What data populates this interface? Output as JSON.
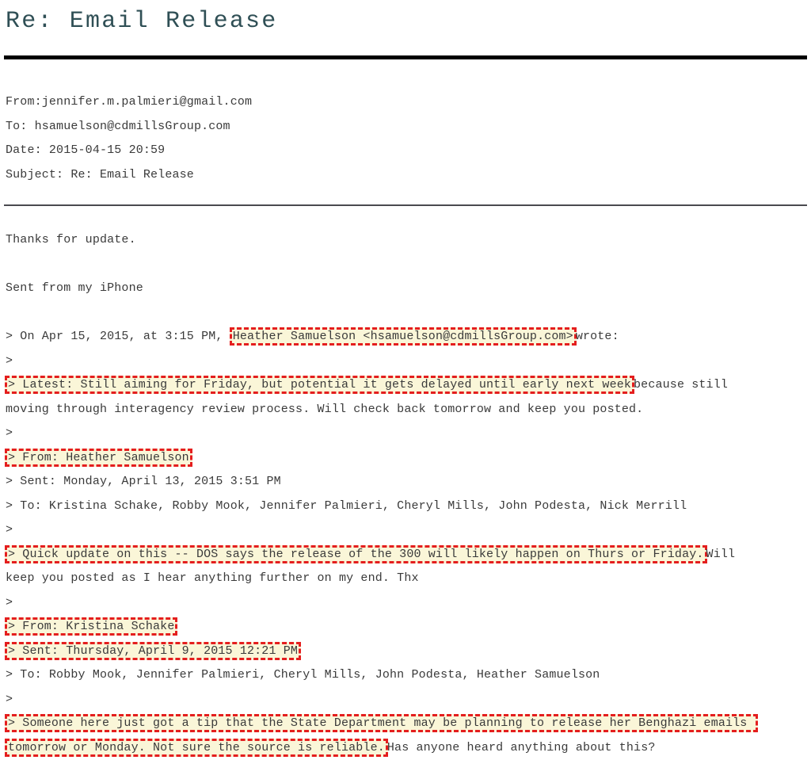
{
  "document": {
    "title": "Re: Email Release",
    "headers": [
      {
        "label": "From:",
        "value": "jennifer.m.palmieri@gmail.com",
        "line": "From:jennifer.m.palmieri@gmail.com"
      },
      {
        "label": "To:",
        "value": "hsamuelson@cdmillsGroup.com",
        "line": "To: hsamuelson@cdmillsGroup.com"
      },
      {
        "label": "Date:",
        "value": "2015-04-15 20:59",
        "line": "Date: 2015-04-15 20:59"
      },
      {
        "label": "Subject:",
        "value": "Re: Email Release",
        "line": "Subject: Re: Email Release"
      }
    ],
    "body": {
      "thanks": "Thanks for update.",
      "signature": "Sent from my iPhone",
      "on_date_prefix": "> On Apr 15, 2015, at 3:15 PM, ",
      "on_date_highlight": "Heather Samuelson <hsamuelson@cdmillsGroup.com>",
      "on_date_suffix": "wrote:",
      "quote_marker": ">",
      "latest_highlight": "> Latest: Still aiming for Friday, but potential it gets delayed until early next week",
      "latest_suffix": "because still",
      "latest_continuation": "moving through interagency review process. Will check back tomorrow and keep you posted.",
      "from_heather_highlight": "> From: Heather Samuelson",
      "sent_heather": "> Sent: Monday, April 13, 2015 3:51 PM",
      "to_heather": "> To: Kristina Schake, Robby Mook, Jennifer Palmieri, Cheryl Mills, John Podesta, Nick Merrill",
      "quick_update_highlight": "> Quick update on this -- DOS says the release of the 300 will likely happen on Thurs or Friday.",
      "quick_update_suffix": "Will",
      "quick_update_continuation": "keep you posted as I hear anything further on my end. Thx",
      "from_kristina_highlight": "> From: Kristina Schake",
      "sent_kristina_highlight": "> Sent: Thursday, April 9, 2015 12:21 PM",
      "to_kristina": "> To: Robby Mook, Jennifer Palmieri, Cheryl Mills, John Podesta, Heather Samuelson",
      "tip_highlight": "> Someone here just got a tip that the State Department may be planning to release her Benghazi emails tomorrow or Monday. Not sure the source is reliable.",
      "tip_suffix": "Has anyone heard anything about this?"
    }
  },
  "colors": {
    "title": "#2f4f55",
    "body_text": "#3a3a3a",
    "highlight_background": "#faf6d8",
    "highlight_border": "#e41e1e",
    "rule_thick": "#000000",
    "rule_thin": "#4a4a50",
    "page_background": "#ffffff"
  }
}
